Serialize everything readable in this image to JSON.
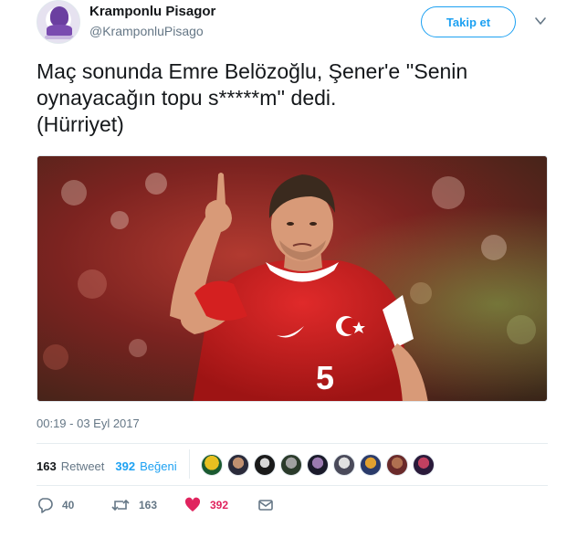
{
  "author": {
    "name": "Kramponlu Pisagor",
    "handle": "@KramponluPisago",
    "avatar_icon": "avatar-logo"
  },
  "follow_button": {
    "label": "Takip et"
  },
  "tweet": {
    "text": "Maç sonunda Emre Belözoğlu, Şener'e ''Senin\noynayacağın topu s*****m'' dedi.\n(Hürriyet)",
    "timestamp": "00:19 - 03 Eyl 2017"
  },
  "stats": {
    "retweets_count": "163",
    "retweets_label": "Retweet",
    "likes_count": "392",
    "likes_label": "Beğeni"
  },
  "actions": {
    "reply_count": "40",
    "retweet_count": "163",
    "like_count": "392"
  },
  "colors": {
    "accent": "#1da1f2",
    "like": "#e0245e",
    "muted": "#657786"
  }
}
